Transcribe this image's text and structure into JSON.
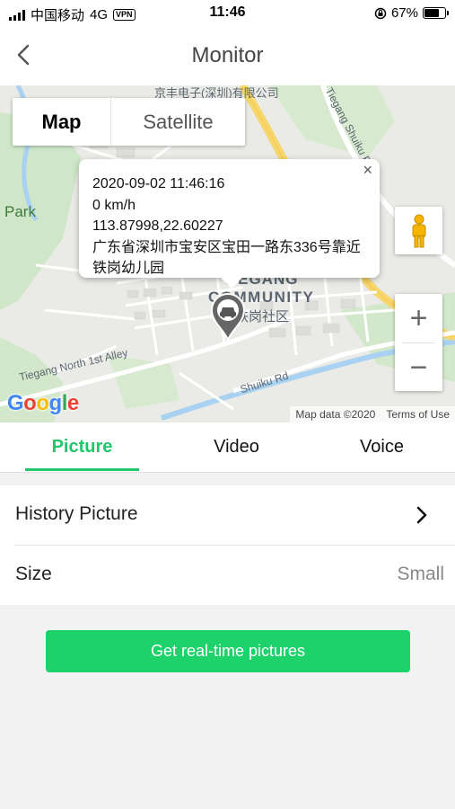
{
  "status_bar": {
    "carrier": "中国移动",
    "network": "4G",
    "vpn": "VPN",
    "time": "11:46",
    "battery_text": "67%",
    "battery_level": 0.67
  },
  "nav": {
    "title": "Monitor"
  },
  "map": {
    "toggle": {
      "map_label": "Map",
      "satellite_label": "Satellite"
    },
    "labels": {
      "park": "Park",
      "community_line1": "TIEGANG",
      "community_line2": "COMMUNITY",
      "community_cn": "铁岗社区",
      "top_cn": "京丰电子(深圳)有限公司",
      "north_alley": "Tiegang North 1st Alley",
      "shuiku_rd": "Shuiku Rd",
      "tiegang_shuiku_rd": "Tiegang Shuiku Rd"
    },
    "info_window": {
      "datetime": "2020-09-02 11:46:16",
      "speed": "0 km/h",
      "coordinates": "113.87998,22.60227",
      "address": "广东省深圳市宝安区宝田一路东336号靠近铁岗幼儿园",
      "close": "×"
    },
    "zoom_in": "+",
    "zoom_out": "−",
    "google": "Google",
    "data_credit": "Map data ©2020",
    "terms": "Terms of Use"
  },
  "tabs": [
    {
      "label": "Picture",
      "active": true
    },
    {
      "label": "Video",
      "active": false
    },
    {
      "label": "Voice",
      "active": false
    }
  ],
  "list": {
    "history_label": "History Picture",
    "size_label": "Size",
    "size_value": "Small"
  },
  "action_button": "Get real-time pictures",
  "colors": {
    "accent": "#1fc66a",
    "button": "#1ed26b"
  }
}
